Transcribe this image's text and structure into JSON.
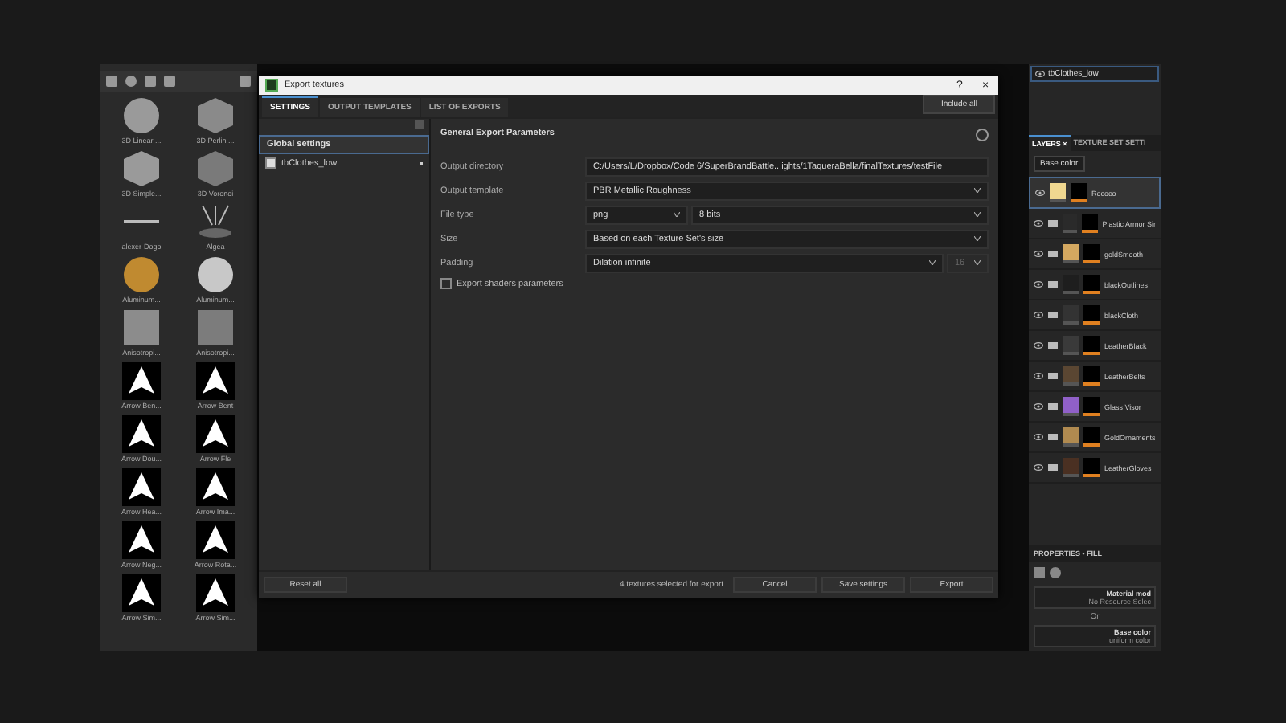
{
  "shelf": {
    "items": [
      {
        "label": "3D Linear ...",
        "kind": "sphere",
        "color": "#9a9a9a"
      },
      {
        "label": "3D Perlin ...",
        "kind": "cube",
        "color": "#8a8a8a"
      },
      {
        "label": "3D Simple...",
        "kind": "cube",
        "color": "#9a9a9a"
      },
      {
        "label": "3D Voronoi",
        "kind": "cube",
        "color": "#7a7a7a"
      },
      {
        "label": "alexer-Dogo",
        "kind": "stroke",
        "color": "#bbbbbb"
      },
      {
        "label": "Algea",
        "kind": "rays"
      },
      {
        "label": "Aluminum...",
        "kind": "sphere",
        "color": "#c08a30"
      },
      {
        "label": "Aluminum...",
        "kind": "sphere",
        "color": "#c8c8c8"
      },
      {
        "label": "Anisotropi...",
        "kind": "square",
        "color": "#8c8c8c"
      },
      {
        "label": "Anisotropi...",
        "kind": "square",
        "color": "#7c7c7c"
      },
      {
        "label": "Arrow Ben...",
        "kind": "arrow"
      },
      {
        "label": "Arrow Bent",
        "kind": "arrow"
      },
      {
        "label": "Arrow Dou...",
        "kind": "arrow"
      },
      {
        "label": "Arrow Fle",
        "kind": "arrow"
      },
      {
        "label": "Arrow Hea...",
        "kind": "arrow"
      },
      {
        "label": "Arrow Ima...",
        "kind": "arrow"
      },
      {
        "label": "Arrow Neg...",
        "kind": "arrow"
      },
      {
        "label": "Arrow Rota...",
        "kind": "arrow"
      },
      {
        "label": "Arrow Sim...",
        "kind": "arrow"
      },
      {
        "label": "Arrow Sim...",
        "kind": "arrow"
      }
    ]
  },
  "dialog": {
    "title": "Export textures",
    "help": "?",
    "close": "×",
    "tabs": [
      {
        "label": "SETTINGS",
        "selected": true
      },
      {
        "label": "OUTPUT TEMPLATES",
        "selected": false
      },
      {
        "label": "LIST OF EXPORTS",
        "selected": false
      }
    ],
    "include_all": "Include all",
    "sets": [
      {
        "label": "Global settings",
        "kind": "header",
        "selected": true
      },
      {
        "label": "tbClothes_low",
        "kind": "set",
        "checked": true,
        "selected": false
      }
    ],
    "section_title": "General Export Parameters",
    "fields": [
      {
        "label": "Output directory",
        "kind": "path",
        "value": "C:/Users/L/Dropbox/Code 6/SuperBrandBattle...ights/1TaqueraBella/finalTextures/testFile"
      },
      {
        "label": "Output template",
        "kind": "select",
        "value": "PBR Metallic Roughness"
      },
      {
        "label": "File type",
        "kind": "pair",
        "value": "png",
        "second": "8 bits"
      },
      {
        "label": "Size",
        "kind": "select",
        "value": "Based on each Texture Set's size"
      },
      {
        "label": "Padding",
        "kind": "pair_disabled",
        "value": "Dilation infinite",
        "second": "16"
      }
    ],
    "export_shaders": {
      "label": "Export shaders parameters",
      "checked": false
    },
    "reset": "Reset all",
    "status": "4 textures selected for export",
    "buttons": [
      "Cancel",
      "Save settings",
      "Export"
    ]
  },
  "right": {
    "set_name": "tbClothes_low",
    "tabs": [
      {
        "label": "LAYERS",
        "selected": true,
        "close": "×"
      },
      {
        "label": "TEXTURE SET SETTI",
        "selected": false
      }
    ],
    "channel": "Base color",
    "layers": [
      {
        "name": "Rococo",
        "kind": "fill",
        "color": "#f0d890",
        "selected": true
      },
      {
        "name": "Plastic Armor Sir",
        "kind": "folder",
        "color": "#2a2a2a",
        "selected": false
      },
      {
        "name": "goldSmooth",
        "kind": "folder",
        "color": "#d4a860",
        "selected": false
      },
      {
        "name": "blackOutlines",
        "kind": "folder",
        "color": "#1e1e1e",
        "selected": false
      },
      {
        "name": "blackCloth",
        "kind": "folder",
        "color": "#333333",
        "selected": false
      },
      {
        "name": "LeatherBlack",
        "kind": "folder",
        "color": "#3a3a3a",
        "selected": false
      },
      {
        "name": "LeatherBelts",
        "kind": "folder",
        "color": "#5a4632",
        "selected": false
      },
      {
        "name": "Glass Visor",
        "kind": "folder",
        "color": "#9060c8",
        "selected": false
      },
      {
        "name": "GoldOrnaments",
        "kind": "folder",
        "color": "#b08a50",
        "selected": false
      },
      {
        "name": "LeatherGloves",
        "kind": "folder",
        "color": "#4a3022",
        "selected": false
      }
    ],
    "properties_title": "PROPERTIES - FILL",
    "material": {
      "title": "Material mod",
      "sub": "No Resource Selec"
    },
    "or": "Or",
    "base": {
      "title": "Base color",
      "sub": "uniform color"
    }
  }
}
